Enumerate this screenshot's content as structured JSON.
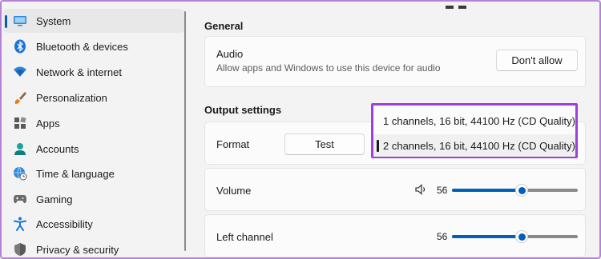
{
  "sidebar": {
    "items": [
      {
        "label": "System",
        "icon": "monitor-icon",
        "active": true
      },
      {
        "label": "Bluetooth & devices",
        "icon": "bluetooth-icon"
      },
      {
        "label": "Network & internet",
        "icon": "wifi-icon"
      },
      {
        "label": "Personalization",
        "icon": "brush-icon"
      },
      {
        "label": "Apps",
        "icon": "apps-icon"
      },
      {
        "label": "Accounts",
        "icon": "person-icon"
      },
      {
        "label": "Time & language",
        "icon": "globe-clock-icon"
      },
      {
        "label": "Gaming",
        "icon": "gamepad-icon"
      },
      {
        "label": "Accessibility",
        "icon": "accessibility-icon"
      },
      {
        "label": "Privacy & security",
        "icon": "shield-icon"
      }
    ]
  },
  "general": {
    "title": "General",
    "audio_label": "Audio",
    "audio_desc": "Allow apps and Windows to use this device for audio",
    "dont_allow_label": "Don't allow"
  },
  "output": {
    "title": "Output settings",
    "format_label": "Format",
    "test_label": "Test",
    "format_options": [
      "1 channels, 16 bit, 44100 Hz (CD Quality)",
      "2 channels, 16 bit, 44100 Hz (CD Quality)"
    ],
    "selected_index": 1,
    "volume_label": "Volume",
    "volume_value": "56",
    "left_channel_label": "Left channel",
    "left_channel_value": "56"
  },
  "colors": {
    "accent": "#005fb8",
    "highlight_border": "#9b3fe0"
  }
}
